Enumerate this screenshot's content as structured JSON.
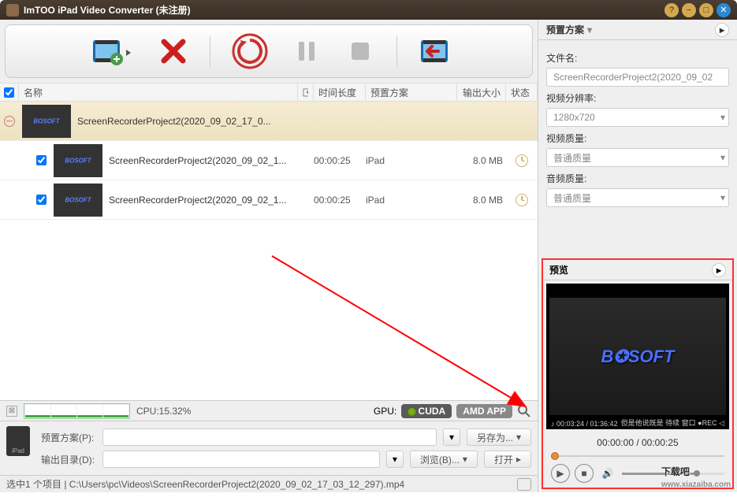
{
  "title": "ImTOO iPad Video Converter (未注册)",
  "columns": {
    "name": "名称",
    "duration": "时间长度",
    "preset": "预置方案",
    "size": "输出大小",
    "status": "状态"
  },
  "rows": [
    {
      "name": "ScreenRecorderProject2(2020_09_02_17_0...",
      "duration": "",
      "preset": "",
      "size": "",
      "status": "minus",
      "sel": true,
      "chk": false
    },
    {
      "name": "ScreenRecorderProject2(2020_09_02_1...",
      "duration": "00:00:25",
      "preset": "iPad",
      "size": "8.0 MB",
      "status": "clock",
      "sub": true,
      "chk": true
    },
    {
      "name": "ScreenRecorderProject2(2020_09_02_1...",
      "duration": "00:00:25",
      "preset": "iPad",
      "size": "8.0 MB",
      "status": "clock",
      "sub": true,
      "chk": true
    }
  ],
  "cpu": {
    "label": "CPU:15.32%"
  },
  "gpu": {
    "label": "GPU:",
    "cuda": "CUDA",
    "amd": "AMD",
    "app": "APP"
  },
  "bottom": {
    "preset_label": "预置方案(P):",
    "output_label": "输出目录(D):",
    "saveas": "另存为...",
    "browse": "浏览(B)...",
    "open": "打开"
  },
  "status": "选中1 个项目 | C:\\Users\\pc\\Videos\\ScreenRecorderProject2(2020_09_02_17_03_12_297).mp4",
  "right": {
    "preset_hdr": "预置方案",
    "filename_label": "文件名:",
    "filename": "ScreenRecorderProject2(2020_09_02",
    "res_label": "视频分辨率:",
    "res": "1280x720",
    "vq_label": "视频质量:",
    "vq": "普通质量",
    "aq_label": "音频质量:",
    "aq": "普通质量",
    "preview_hdr": "预览",
    "preview_time": "00:00:00 / 00:00:25",
    "osd": "♪ 00:03:24 / 01:36:42",
    "osd2": "但是他说既是    待续  窗口 ●REC ◁",
    "logo": "B✪SOFT"
  },
  "watermark": {
    "text": "下载吧",
    "url": "www.xiazaiba.com"
  }
}
